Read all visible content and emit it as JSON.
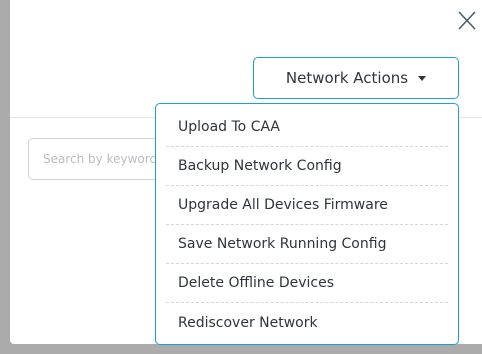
{
  "dialog": {
    "close_icon": "close-icon"
  },
  "search": {
    "placeholder": "Search by keyword"
  },
  "network_actions": {
    "label": "Network Actions",
    "caret_icon": "caret-down-icon",
    "accent_color": "#1ba1d2"
  },
  "menu": {
    "items": [
      {
        "label": "Upload To CAA"
      },
      {
        "label": "Backup Network Config"
      },
      {
        "label": "Upgrade All Devices Firmware"
      },
      {
        "label": "Save Network Running Config"
      },
      {
        "label": "Delete Offline Devices"
      },
      {
        "label": "Rediscover Network"
      }
    ]
  }
}
